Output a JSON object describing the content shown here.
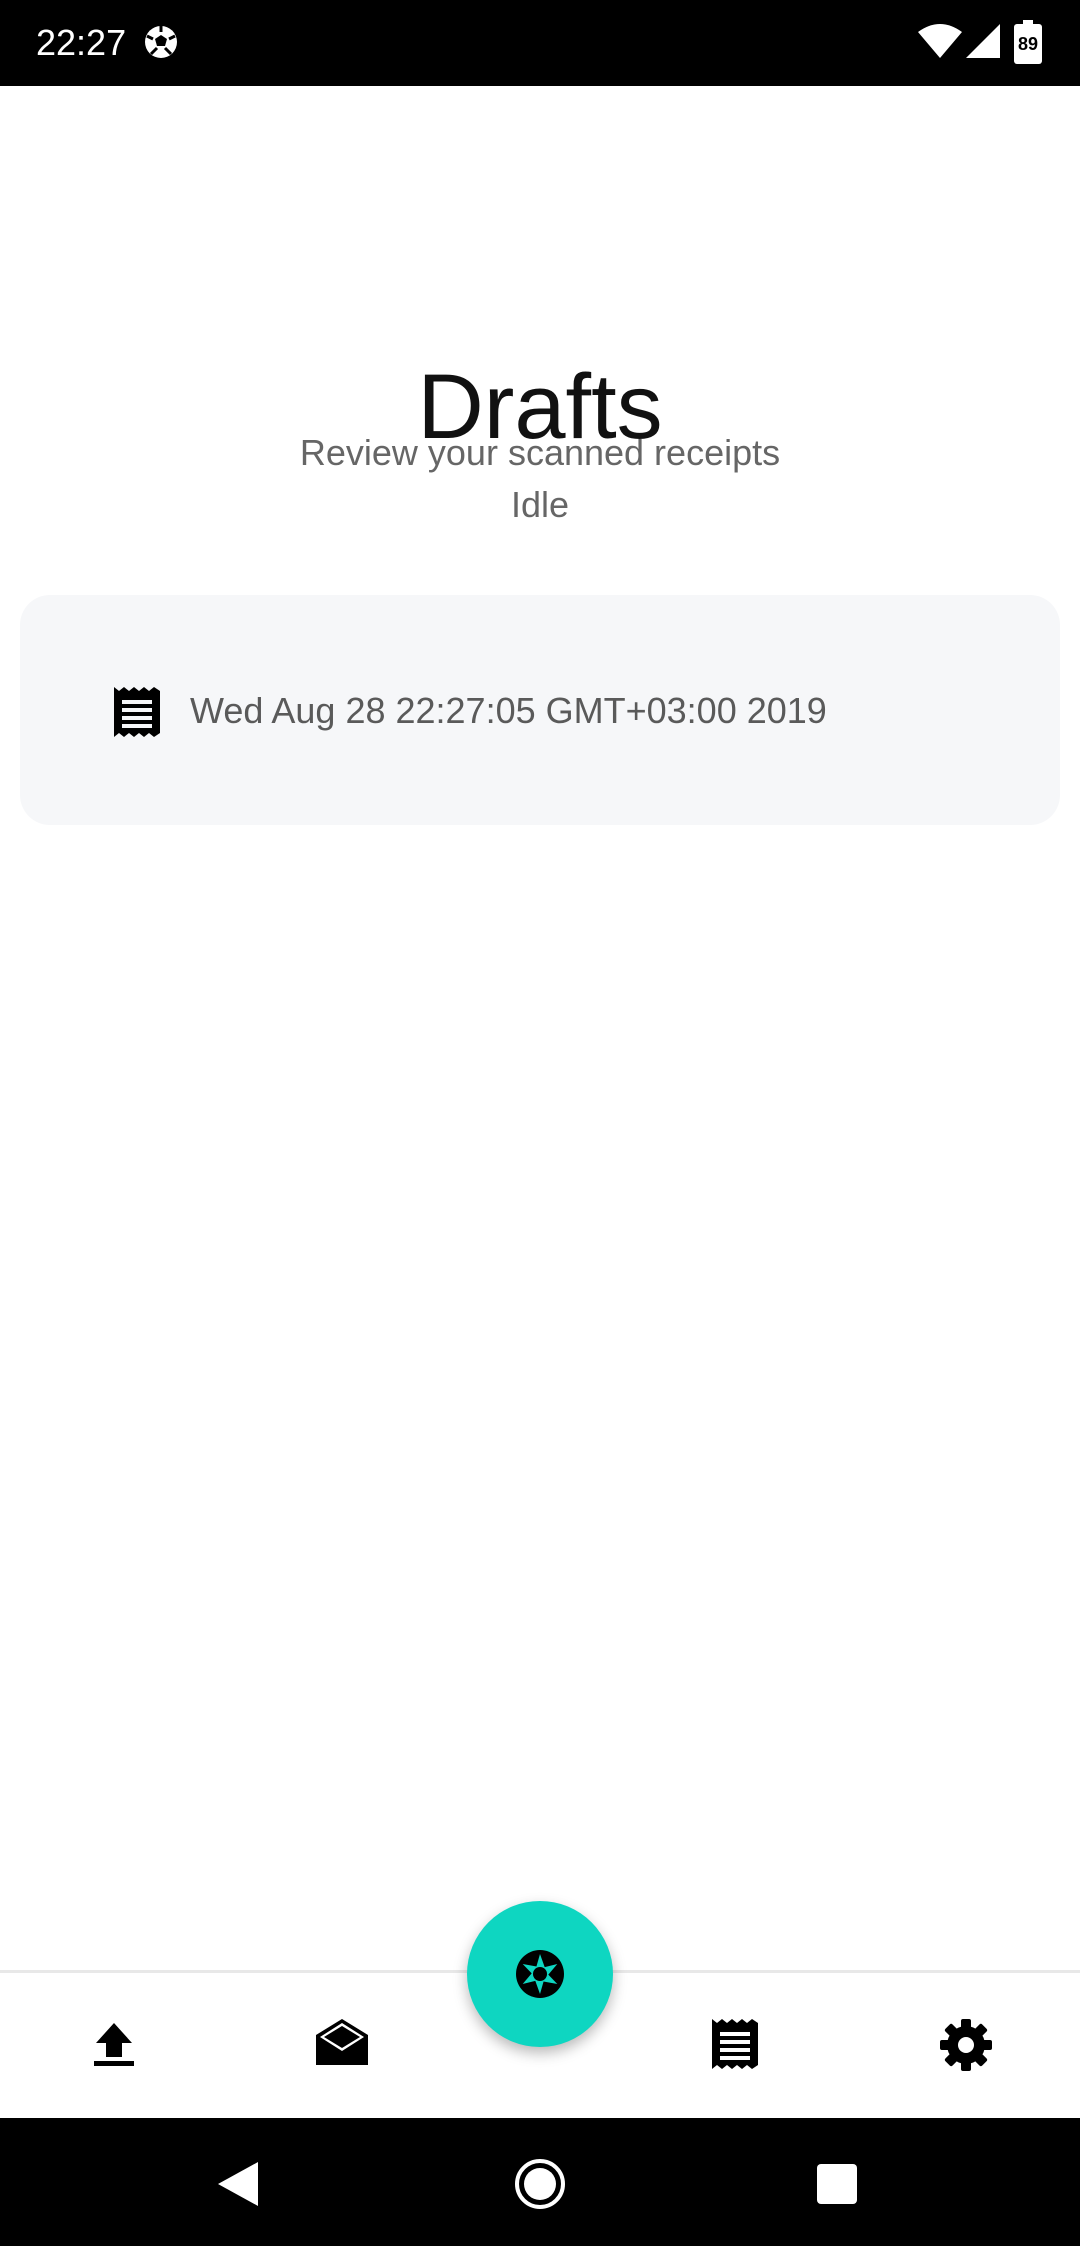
{
  "status_bar": {
    "time": "22:27",
    "battery": "89"
  },
  "header": {
    "title": "Drafts",
    "subtitle": "Review your scanned receipts",
    "status": "Idle"
  },
  "drafts": [
    {
      "label": "Wed Aug 28 22:27:05 GMT+03:00 2019"
    }
  ],
  "bottom_nav": {
    "items": [
      {
        "icon": "upload-icon"
      },
      {
        "icon": "inbox-icon"
      },
      {
        "icon": "camera-shutter-icon"
      },
      {
        "icon": "receipt-icon"
      },
      {
        "icon": "settings-icon"
      }
    ]
  },
  "colors": {
    "accent": "#0ed6c1",
    "card_background": "#f6f7f9",
    "text_primary": "#111111",
    "text_secondary": "#666666"
  }
}
